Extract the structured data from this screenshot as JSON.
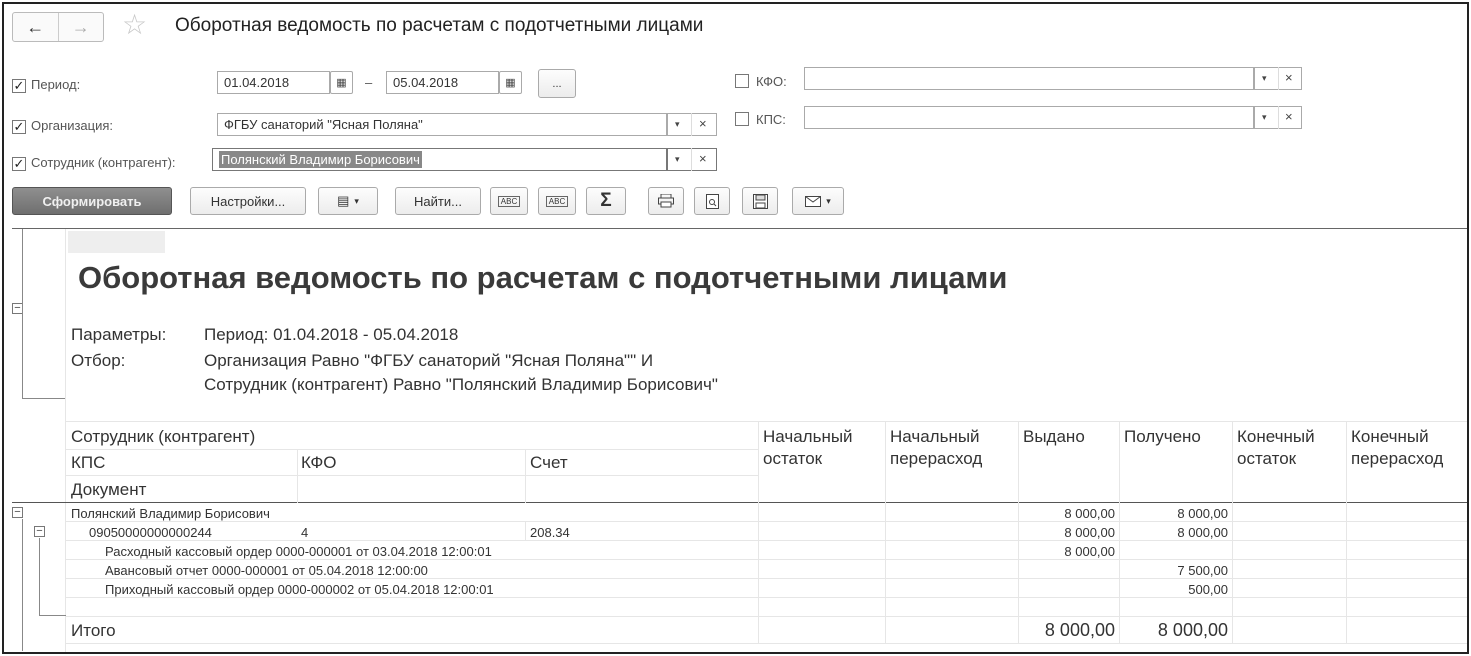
{
  "window": {
    "title": "Оборотная ведомость по расчетам с подотчетными лицами",
    "nav_back": "←",
    "nav_forward": "→",
    "star": "☆"
  },
  "filters": {
    "period": {
      "label": "Период:",
      "from": "01.04.2018",
      "to": "05.04.2018",
      "dash": "–",
      "dots": "...",
      "checked": true
    },
    "organization": {
      "label": "Организация:",
      "value": "ФГБУ санаторий \"Ясная Поляна\"",
      "checked": true
    },
    "employee": {
      "label": "Сотрудник (контрагент):",
      "value": "Полянский Владимир Борисович",
      "checked": true
    },
    "kfo": {
      "label": "КФО:",
      "value": "",
      "checked": false
    },
    "kps": {
      "label": "КПС:",
      "value": "",
      "checked": false
    },
    "check_mark": "✓",
    "dropdown_glyph": "▾",
    "clear_glyph": "×"
  },
  "toolbar": {
    "generate": "Сформировать",
    "settings": "Настройки...",
    "find": "Найти...",
    "sum": "Σ",
    "dropdown_glyph": "▾"
  },
  "report": {
    "title": "Оборотная ведомость по расчетам с подотчетными лицами",
    "params_label": "Параметры:",
    "params_value": "Период: 01.04.2018 - 05.04.2018",
    "filter_label": "Отбор:",
    "filter_line1": "Организация Равно \"ФГБУ санаторий \"Ясная Поляна\"\" И",
    "filter_line2": "Сотрудник (контрагент) Равно \"Полянский Владимир Борисович\"",
    "headers": {
      "employee": "Сотрудник (контрагент)",
      "kps": "КПС",
      "kfo": "КФО",
      "account": "Счет",
      "document": "Документ",
      "open_balance": [
        "Начальный",
        "остаток"
      ],
      "open_overspend": [
        "Начальный",
        "перерасход"
      ],
      "issued": "Выдано",
      "received": "Получено",
      "close_balance": [
        "Конечный",
        "остаток"
      ],
      "close_overspend": [
        "Конечный",
        "перерасход"
      ]
    },
    "rows": [
      {
        "label": "Полянский Владимир Борисович",
        "issued": "8 000,00",
        "received": "8 000,00"
      },
      {
        "kps": "09050000000000244",
        "kfo": "4",
        "account": "208.34",
        "issued": "8 000,00",
        "received": "8 000,00"
      },
      {
        "label": "Расходный кассовый ордер 0000-000001 от 03.04.2018 12:00:01",
        "issued": "8 000,00",
        "received": ""
      },
      {
        "label": "Авансовый отчет 0000-000001 от 05.04.2018 12:00:00",
        "issued": "",
        "received": "7 500,00"
      },
      {
        "label": "Приходный кассовый ордер 0000-000002 от 05.04.2018 12:00:01",
        "issued": "",
        "received": "500,00"
      }
    ],
    "total": {
      "label": "Итого",
      "issued": "8 000,00",
      "received": "8 000,00"
    }
  }
}
